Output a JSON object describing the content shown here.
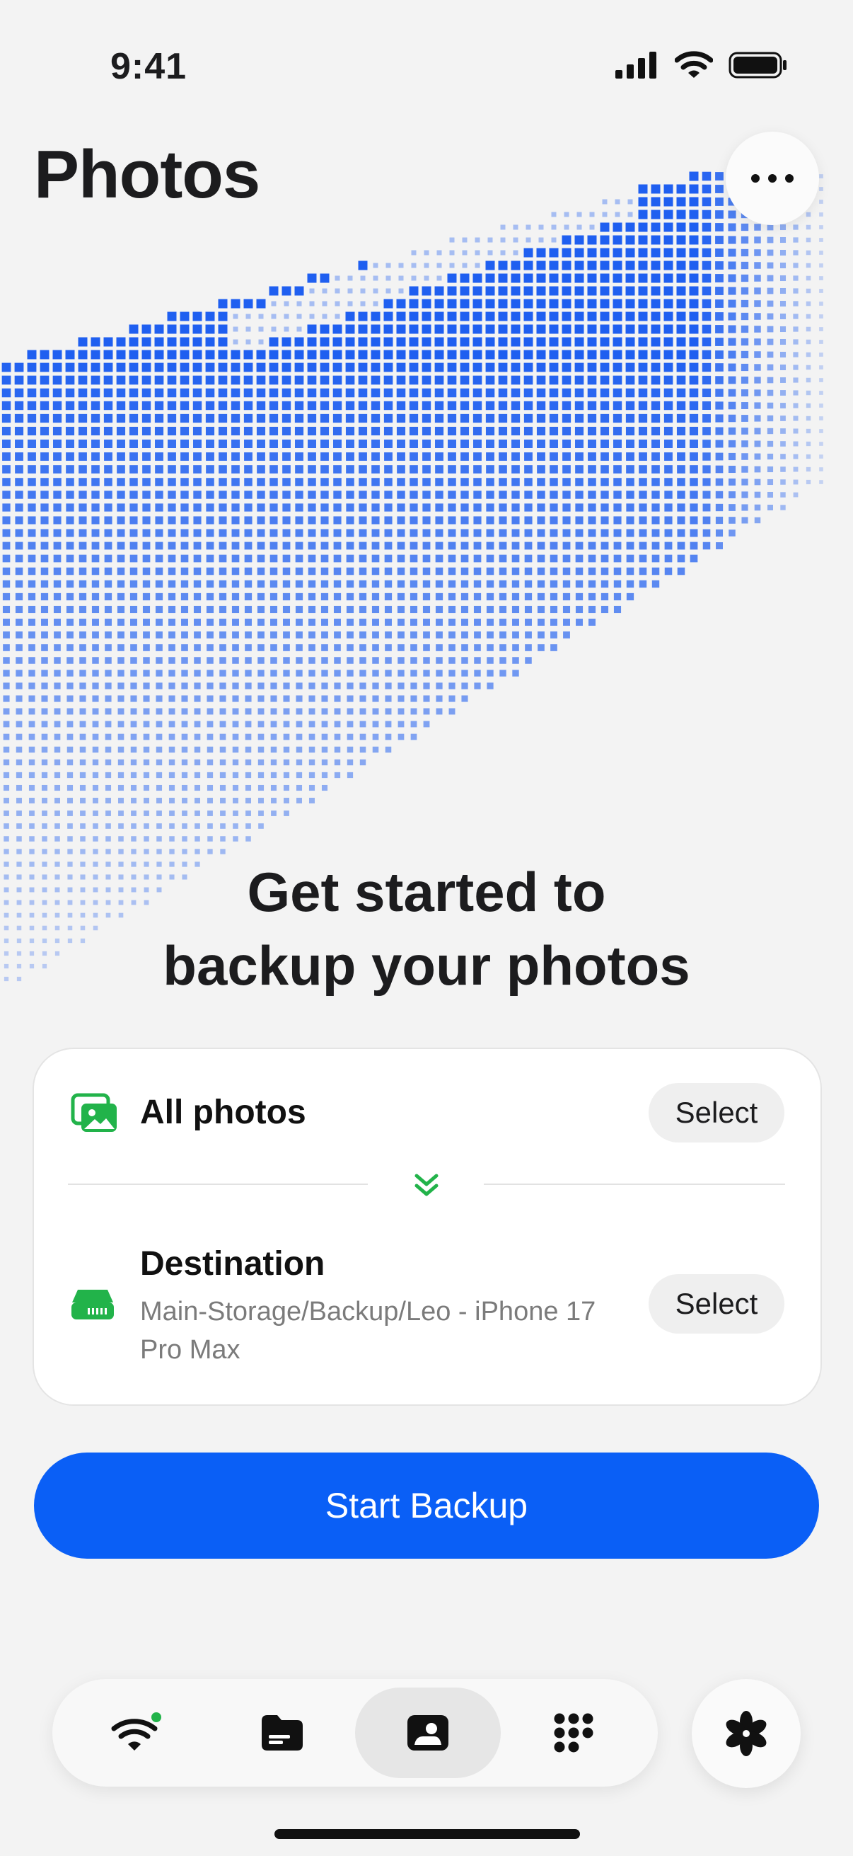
{
  "status_bar": {
    "time": "9:41"
  },
  "header": {
    "title": "Photos",
    "more_icon": "ellipsis-icon"
  },
  "hero": {
    "line1": "Get started to",
    "line2": "backup your photos"
  },
  "source": {
    "icon": "photos-icon",
    "title": "All photos",
    "select_label": "Select"
  },
  "destination": {
    "icon": "drive-icon",
    "title": "Destination",
    "path": "Main-Storage/Backup/Leo - iPhone 17 Pro Max",
    "select_label": "Select"
  },
  "primary_button": {
    "label": "Start Backup"
  },
  "tab_bar": {
    "tabs": [
      {
        "name": "wifi",
        "icon": "wifi-icon",
        "active": false,
        "badge": true
      },
      {
        "name": "files",
        "icon": "folder-icon",
        "active": false
      },
      {
        "name": "photos",
        "icon": "photo-icon",
        "active": true
      },
      {
        "name": "apps",
        "icon": "grid-icon",
        "active": false
      }
    ],
    "fab_icon": "flower-icon"
  },
  "colors": {
    "accent": "#0a5ff6",
    "success": "#22b34a",
    "background": "#f3f3f3",
    "dots": "#1f5ff0"
  }
}
